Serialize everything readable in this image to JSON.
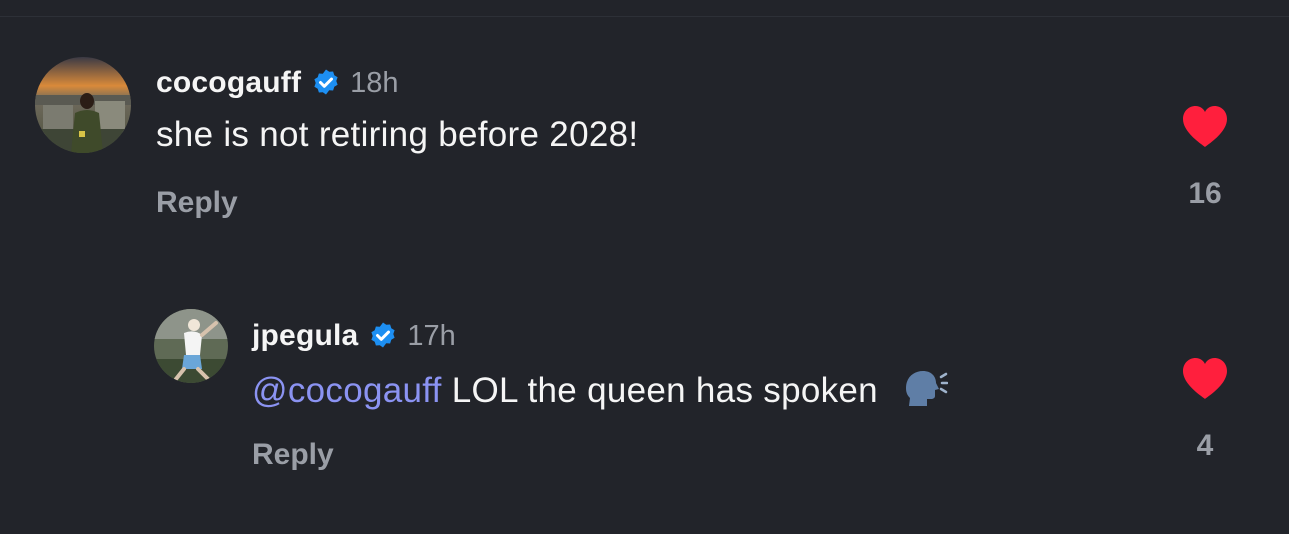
{
  "colors": {
    "background": "#22242a",
    "verified_badge": "#1d8ff2",
    "heart": "#ff1f3d",
    "mention": "#8b93f2",
    "muted_text": "#9a9ea6"
  },
  "comments": [
    {
      "username": "cocogauff",
      "verified_icon": "verified-badge-icon",
      "time": "18h",
      "text": "she is not retiring before 2028!",
      "reply_label": "Reply",
      "like_icon": "heart-icon",
      "like_count": "16"
    },
    {
      "username": "jpegula",
      "verified_icon": "verified-badge-icon",
      "time": "17h",
      "mention": "@cocogauff",
      "text": " LOL the queen has spoken",
      "emoji_icon": "speaking-head-icon",
      "reply_label": "Reply",
      "like_icon": "heart-icon",
      "like_count": "4"
    }
  ]
}
